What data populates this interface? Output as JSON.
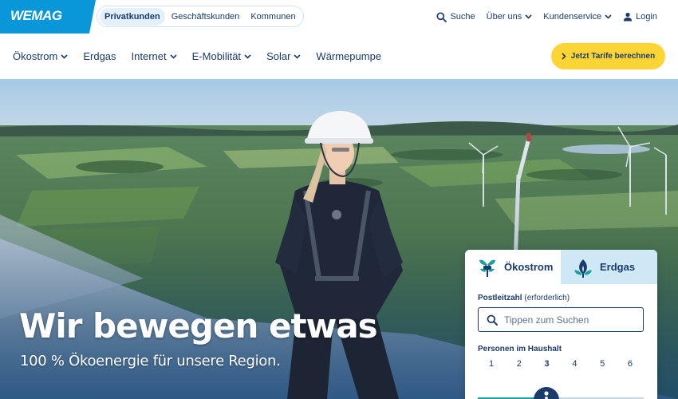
{
  "brand": {
    "logo_text": "WEMAG",
    "color": "#0a97d9"
  },
  "segments": [
    {
      "label": "Privatkunden",
      "active": true
    },
    {
      "label": "Geschäftskunden",
      "active": false
    },
    {
      "label": "Kommunen",
      "active": false
    }
  ],
  "top_right": {
    "search": "Suche",
    "about": "Über uns",
    "service": "Kundenservice",
    "login": "Login"
  },
  "nav": {
    "items": [
      {
        "label": "Ökostrom",
        "has_dropdown": true
      },
      {
        "label": "Erdgas",
        "has_dropdown": false
      },
      {
        "label": "Internet",
        "has_dropdown": true
      },
      {
        "label": "E-Mobilität",
        "has_dropdown": true
      },
      {
        "label": "Solar",
        "has_dropdown": true
      },
      {
        "label": "Wärmepumpe",
        "has_dropdown": false
      }
    ],
    "cta_label": "Jetzt Tarife berechnen",
    "cta_color": "#fcd535"
  },
  "hero": {
    "title": "Wir bewegen etwas",
    "subtitle": "100 % Ökoenergie für unsere Region."
  },
  "calculator": {
    "tabs": [
      {
        "label": "Ökostrom",
        "icon": "plug-leaf-icon",
        "active": true
      },
      {
        "label": "Erdgas",
        "icon": "flame-leaf-icon",
        "active": false
      }
    ],
    "zip_label": "Postleitzahl",
    "zip_optional": "(erforderlich)",
    "zip_placeholder": "Tippen zum Suchen",
    "persons_label": "Personen im Haushalt",
    "persons_options": [
      "1",
      "2",
      "3",
      "4",
      "5",
      "6"
    ],
    "persons_selected": "3",
    "accent_color": "#1ba0a0"
  }
}
